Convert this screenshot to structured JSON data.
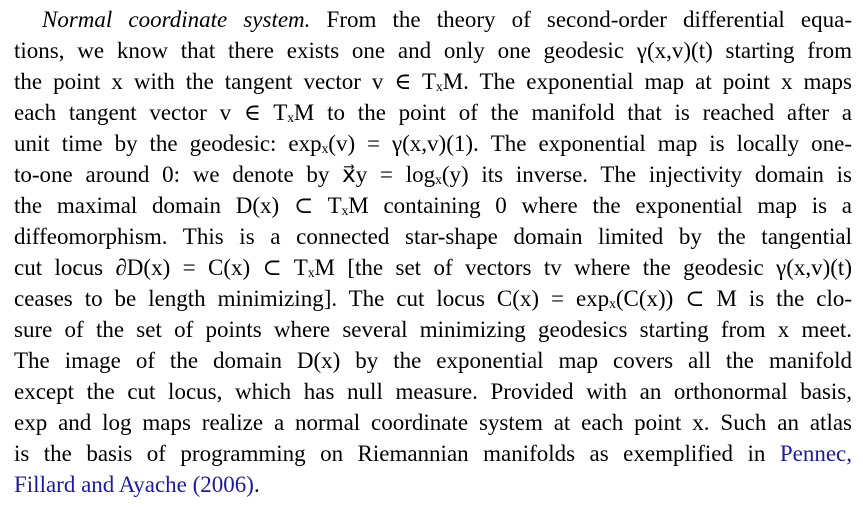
{
  "paragraph": {
    "runin_heading": "Normal coordinate system.",
    "lines": [
      "From the theory of second-order differential equa-",
      "tions, we know that there exists one and only one geodesic γ(x,v)(t) starting from",
      "the point x with the tangent vector v ∈ TₓM. The exponential map at point x maps",
      "each tangent vector v ∈ TₓM to the point of the manifold that is reached after a",
      "unit time by the geodesic: expₓ(v) = γ(x,v)(1). The exponential map is locally one-",
      "to-one around 0: we denote by x⃗y = logₓ(y) its inverse. The injectivity domain is",
      "the maximal domain D(x) ⊂ TₓM containing 0 where the exponential map is a",
      "diffeomorphism. This is a connected star-shape domain limited by the tangential",
      "cut locus ∂D(x) = C(x) ⊂ TₓM [the set of vectors tv where the geodesic γ(x,v)(t)",
      "ceases to be length minimizing]. The cut locus C(x) = expₓ(C(x)) ⊂ M is the clo-",
      "sure of the set of points where several minimizing geodesics starting from x meet.",
      "The image of the domain D(x) by the exponential map covers all the manifold",
      "except the cut locus, which has null measure. Provided with an orthonormal basis,",
      "exp and log maps realize a normal coordinate system at each point x. Such an atlas",
      "is the basis of programming on Riemannian manifolds as exemplified in"
    ],
    "citation_line1": "Pennec,",
    "citation_line2": "Fillard and Ayache (2006)",
    "closing": "."
  }
}
